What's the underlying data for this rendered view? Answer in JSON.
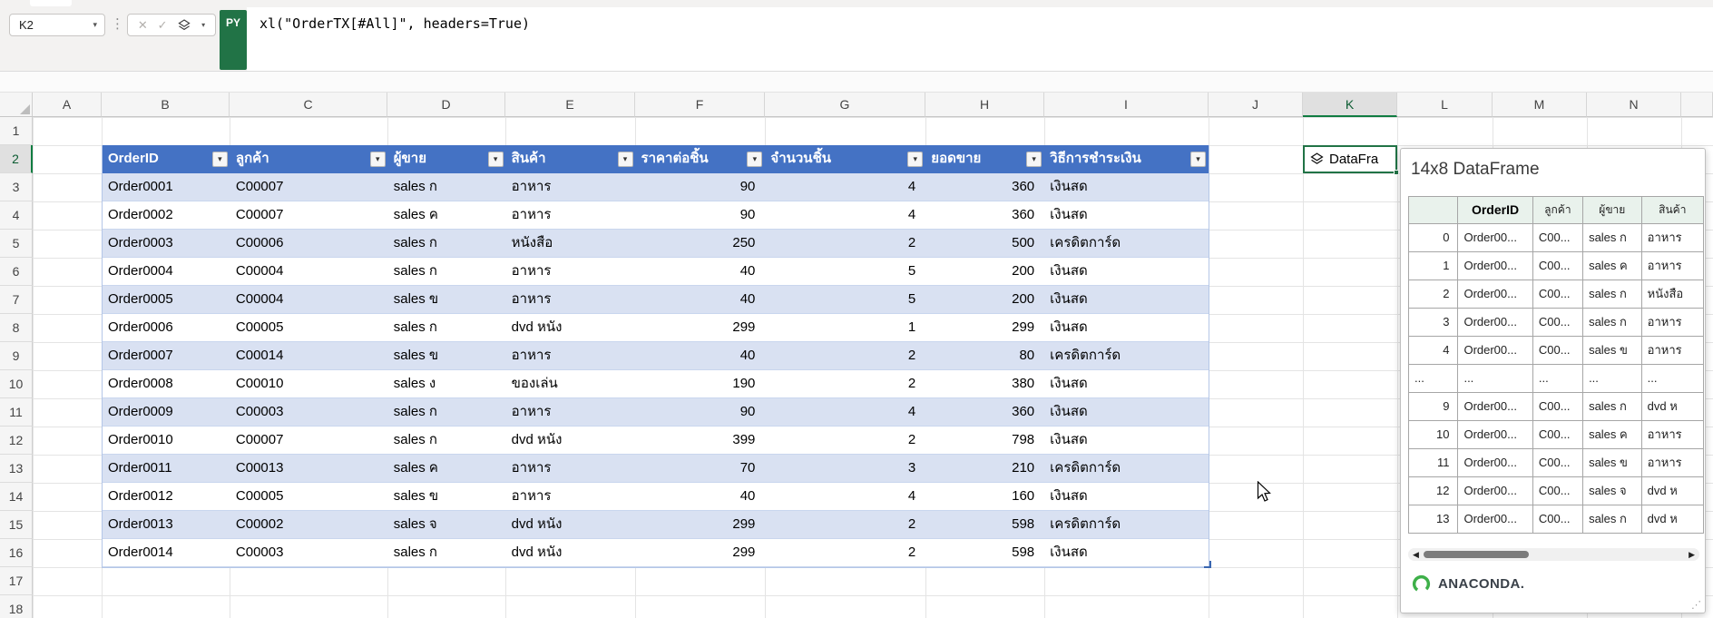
{
  "formula_bar": {
    "cell_reference": "K2",
    "language_badge": "PY",
    "formula": "xl(\"OrderTX[#All]\", headers=True)"
  },
  "sheet": {
    "column_letters": [
      "A",
      "B",
      "C",
      "D",
      "E",
      "F",
      "G",
      "H",
      "I",
      "J",
      "K",
      "L",
      "M",
      "N"
    ],
    "row_numbers": [
      "1",
      "2",
      "3",
      "4",
      "5",
      "6",
      "7",
      "8",
      "9",
      "10",
      "11",
      "12",
      "13",
      "14",
      "15",
      "16",
      "17",
      "18"
    ],
    "selected_column": "K",
    "selected_row": "2",
    "selected_cell": {
      "reference": "K2",
      "value_preview": "DataFra"
    }
  },
  "order_table": {
    "headers": [
      "OrderID",
      "ลูกค้า",
      "ผู้ขาย",
      "สินค้า",
      "ราคาต่อชิ้น",
      "จำนวนชิ้น",
      "ยอดขาย",
      "วิธีการชำระเงิน"
    ],
    "rows": [
      [
        "Order0001",
        "C00007",
        "sales ก",
        "อาหาร",
        "90",
        "4",
        "360",
        "เงินสด"
      ],
      [
        "Order0002",
        "C00007",
        "sales ค",
        "อาหาร",
        "90",
        "4",
        "360",
        "เงินสด"
      ],
      [
        "Order0003",
        "C00006",
        "sales ก",
        "หนังสือ",
        "250",
        "2",
        "500",
        "เครดิตการ์ด"
      ],
      [
        "Order0004",
        "C00004",
        "sales ก",
        "อาหาร",
        "40",
        "5",
        "200",
        "เงินสด"
      ],
      [
        "Order0005",
        "C00004",
        "sales ข",
        "อาหาร",
        "40",
        "5",
        "200",
        "เงินสด"
      ],
      [
        "Order0006",
        "C00005",
        "sales ก",
        "dvd หนัง",
        "299",
        "1",
        "299",
        "เงินสด"
      ],
      [
        "Order0007",
        "C00014",
        "sales ข",
        "อาหาร",
        "40",
        "2",
        "80",
        "เครดิตการ์ด"
      ],
      [
        "Order0008",
        "C00010",
        "sales ง",
        "ของเล่น",
        "190",
        "2",
        "380",
        "เงินสด"
      ],
      [
        "Order0009",
        "C00003",
        "sales ก",
        "อาหาร",
        "90",
        "4",
        "360",
        "เงินสด"
      ],
      [
        "Order0010",
        "C00007",
        "sales ก",
        "dvd หนัง",
        "399",
        "2",
        "798",
        "เงินสด"
      ],
      [
        "Order0011",
        "C00013",
        "sales ค",
        "อาหาร",
        "70",
        "3",
        "210",
        "เครดิตการ์ด"
      ],
      [
        "Order0012",
        "C00005",
        "sales ข",
        "อาหาร",
        "40",
        "4",
        "160",
        "เงินสด"
      ],
      [
        "Order0013",
        "C00002",
        "sales จ",
        "dvd หนัง",
        "299",
        "2",
        "598",
        "เครดิตการ์ด"
      ],
      [
        "Order0014",
        "C00003",
        "sales ก",
        "dvd หนัง",
        "299",
        "2",
        "598",
        "เงินสด"
      ]
    ]
  },
  "dataframe_card": {
    "title": "14x8 DataFrame",
    "table": {
      "columns": [
        "",
        "OrderID",
        "ลูกค้า",
        "ผู้ขาย",
        "สินค้า"
      ],
      "rows": [
        [
          "0",
          "Order00...",
          "C00...",
          "sales ก",
          "อาหาร"
        ],
        [
          "1",
          "Order00...",
          "C00...",
          "sales ค",
          "อาหาร"
        ],
        [
          "2",
          "Order00...",
          "C00...",
          "sales ก",
          "หนังสือ"
        ],
        [
          "3",
          "Order00...",
          "C00...",
          "sales ก",
          "อาหาร"
        ],
        [
          "4",
          "Order00...",
          "C00...",
          "sales ข",
          "อาหาร"
        ],
        [
          "...",
          "...",
          "...",
          "...",
          "..."
        ],
        [
          "9",
          "Order00...",
          "C00...",
          "sales ก",
          "dvd ห"
        ],
        [
          "10",
          "Order00...",
          "C00...",
          "sales ค",
          "อาหาร"
        ],
        [
          "11",
          "Order00...",
          "C00...",
          "sales ข",
          "อาหาร"
        ],
        [
          "12",
          "Order00...",
          "C00...",
          "sales จ",
          "dvd ห"
        ],
        [
          "13",
          "Order00...",
          "C00...",
          "sales ก",
          "dvd ห"
        ]
      ]
    },
    "brand_text": "ANACONDA."
  },
  "colors": {
    "excel_green": "#217346",
    "table_header_blue": "#4472C4",
    "banded_row": "#D9E1F2",
    "card_header_bg": "#E9F2EC",
    "anaconda_green": "#3EB049"
  }
}
